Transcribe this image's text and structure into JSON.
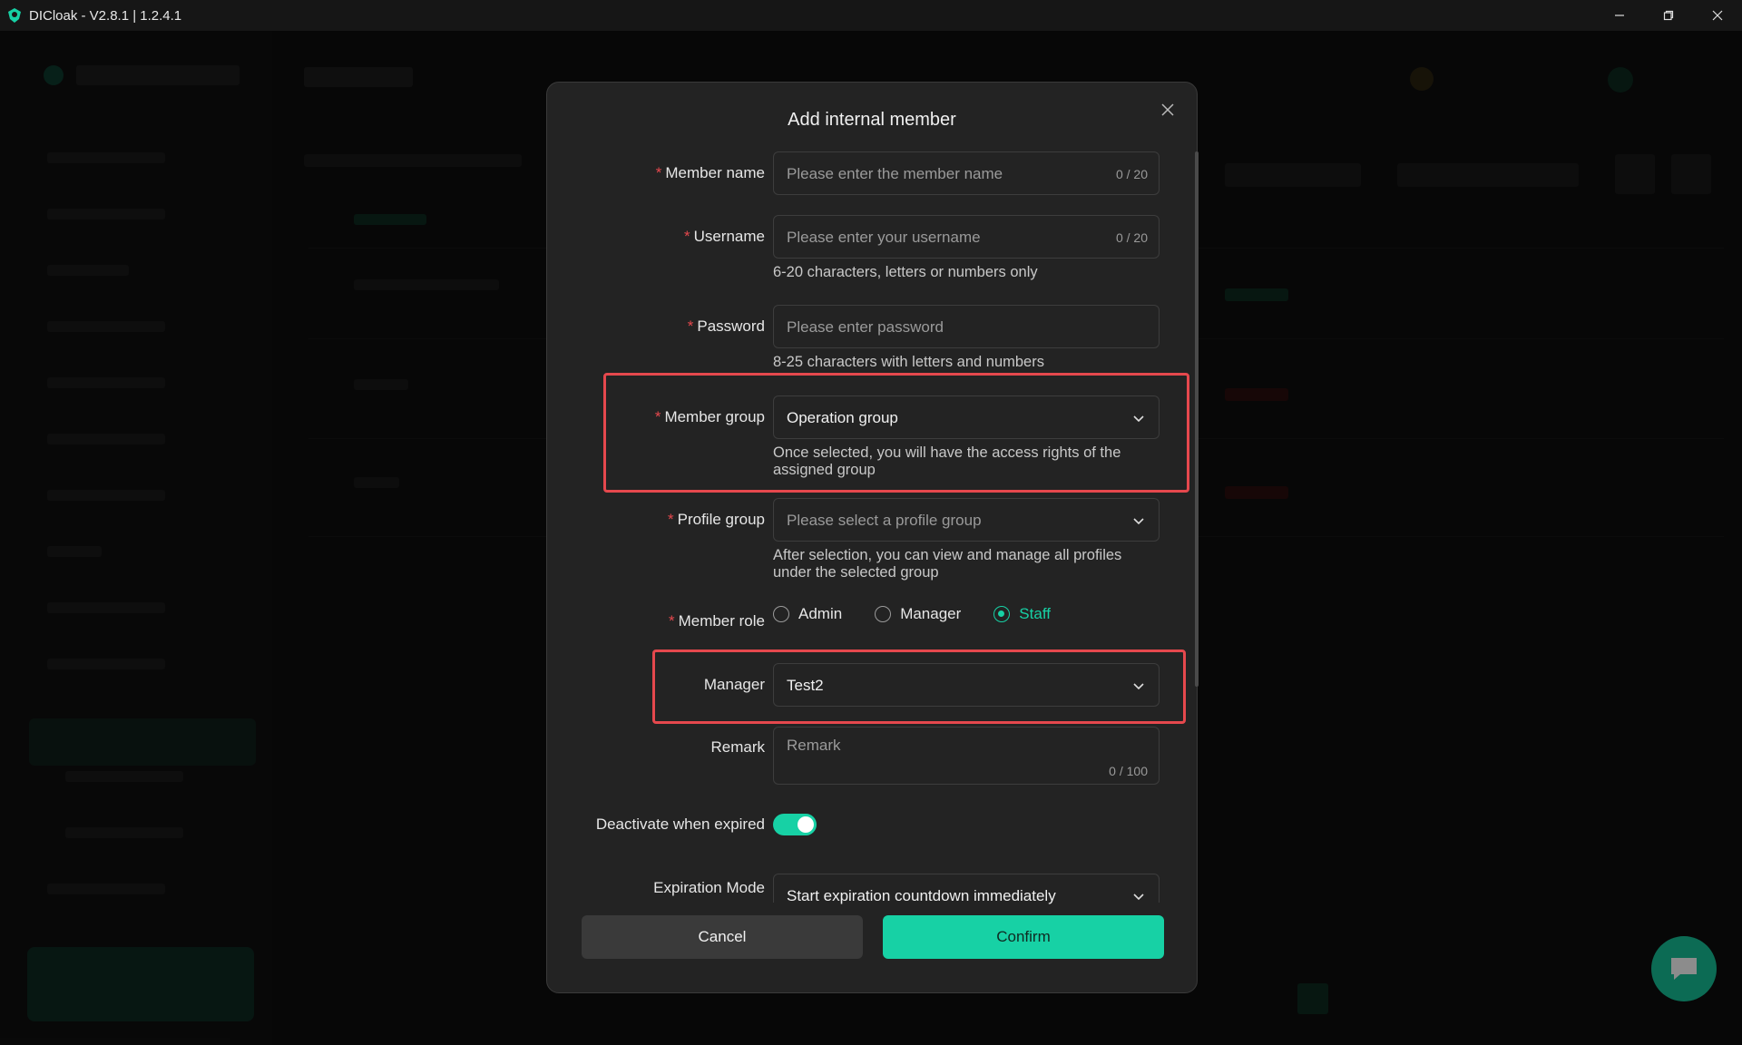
{
  "window": {
    "title": "DICloak - V2.8.1 | 1.2.4.1"
  },
  "modal": {
    "title": "Add internal member",
    "fields": {
      "member_name": {
        "label": "Member name",
        "placeholder": "Please enter the member name",
        "counter": "0 / 20"
      },
      "username": {
        "label": "Username",
        "placeholder": "Please enter your username",
        "counter": "0 / 20",
        "hint": "6-20 characters, letters or numbers only"
      },
      "password": {
        "label": "Password",
        "placeholder": "Please enter password",
        "hint": "8-25 characters with letters and numbers"
      },
      "member_group": {
        "label": "Member group",
        "value": "Operation group",
        "hint": "Once selected, you will have the access rights of the assigned group"
      },
      "profile_group": {
        "label": "Profile group",
        "placeholder": "Please select a profile group",
        "hint": "After selection, you can view and manage all profiles under the selected group"
      },
      "member_role": {
        "label": "Member role",
        "options": [
          "Admin",
          "Manager",
          "Staff"
        ],
        "selected": "Staff"
      },
      "manager": {
        "label": "Manager",
        "value": "Test2"
      },
      "remark": {
        "label": "Remark",
        "placeholder": "Remark",
        "counter": "0 / 100"
      },
      "deactivate": {
        "label": "Deactivate when expired",
        "enabled": true
      },
      "expiration_mode": {
        "label": "Expiration Mode",
        "value": "Start expiration countdown immediately"
      }
    },
    "buttons": {
      "cancel": "Cancel",
      "confirm": "Confirm"
    }
  },
  "colors": {
    "accent": "#17d1a5",
    "highlight": "#e5484d",
    "required": "#e5484d",
    "modal_bg": "#232323"
  }
}
